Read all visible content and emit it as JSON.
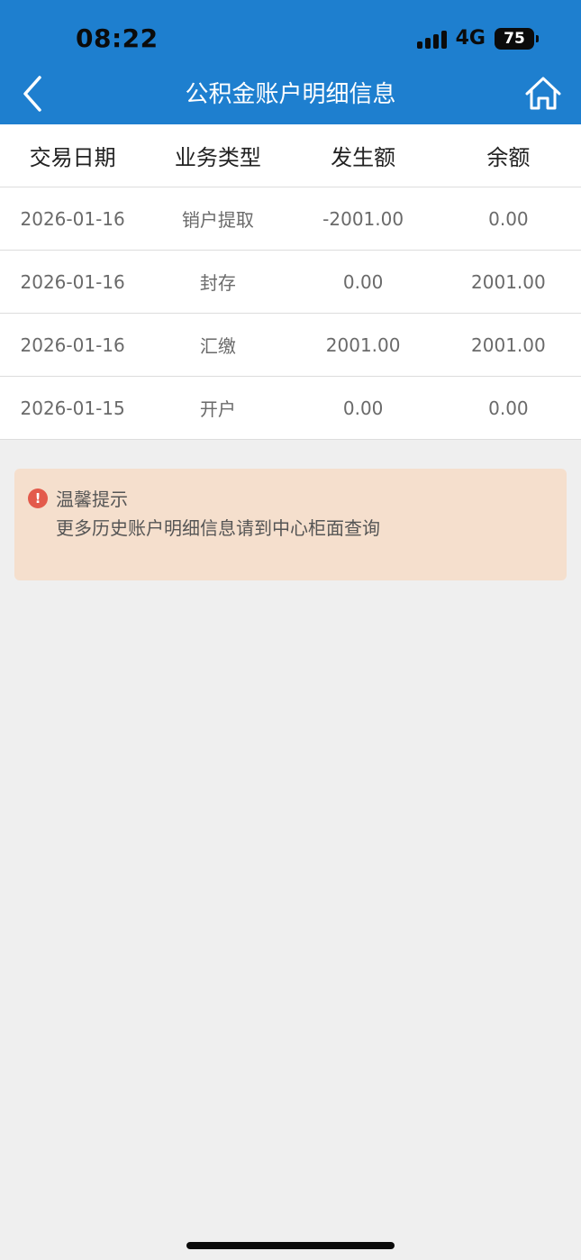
{
  "status_bar": {
    "time": "08:22",
    "network": "4G",
    "battery": "75"
  },
  "nav": {
    "title": "公积金账户明细信息",
    "back_icon": "chevron-left-icon",
    "home_icon": "home-icon"
  },
  "table": {
    "headers": [
      "交易日期",
      "业务类型",
      "发生额",
      "余额"
    ],
    "rows": [
      [
        "2026-01-16",
        "销户提取",
        "-2001.00",
        "0.00"
      ],
      [
        "2026-01-16",
        "封存",
        "0.00",
        "2001.00"
      ],
      [
        "2026-01-16",
        "汇缴",
        "2001.00",
        "2001.00"
      ],
      [
        "2026-01-15",
        "开户",
        "0.00",
        "0.00"
      ]
    ]
  },
  "notice": {
    "icon": "alert-icon",
    "icon_glyph": "!",
    "title": "温馨提示",
    "body": "更多历史账户明细信息请到中心柜面查询"
  },
  "colors": {
    "header_bg": "#1e7fcf",
    "page_bg": "#efefef",
    "notice_bg": "#f5dfcd",
    "alert": "#e35a4b"
  }
}
